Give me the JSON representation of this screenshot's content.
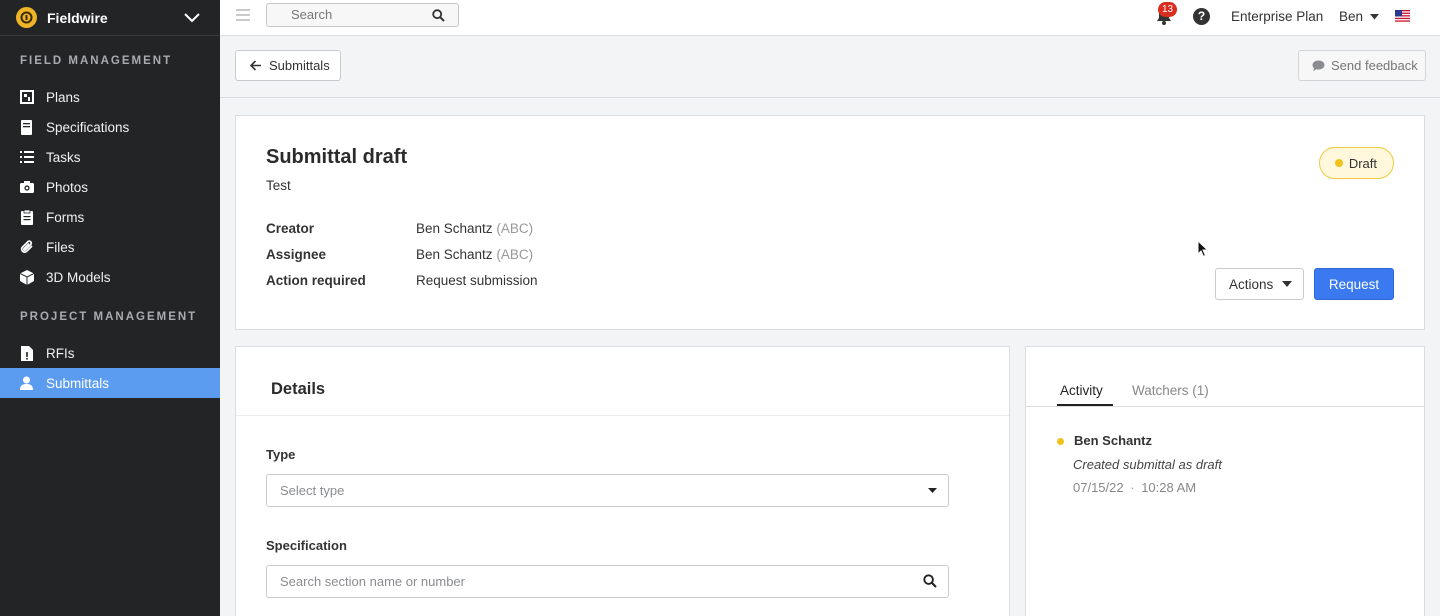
{
  "app": {
    "name": "Fieldwire"
  },
  "sidebar": {
    "sections": [
      {
        "title": "FIELD MANAGEMENT",
        "items": [
          {
            "label": "Plans",
            "icon": "plans-icon"
          },
          {
            "label": "Specifications",
            "icon": "specifications-icon"
          },
          {
            "label": "Tasks",
            "icon": "tasks-icon"
          },
          {
            "label": "Photos",
            "icon": "camera-icon"
          },
          {
            "label": "Forms",
            "icon": "forms-icon"
          },
          {
            "label": "Files",
            "icon": "paperclip-icon"
          },
          {
            "label": "3D Models",
            "icon": "cube-icon"
          }
        ]
      },
      {
        "title": "PROJECT MANAGEMENT",
        "items": [
          {
            "label": "RFIs",
            "icon": "rfi-icon"
          },
          {
            "label": "Submittals",
            "icon": "person-icon",
            "active": true
          }
        ]
      }
    ]
  },
  "topbar": {
    "search_placeholder": "Search",
    "notification_count": "13",
    "help_label": "?",
    "plan_label": "Enterprise Plan",
    "user_label": "Ben",
    "flag_icon": "us-flag-icon"
  },
  "subheader": {
    "back_label": "Submittals",
    "feedback_label": "Send feedback"
  },
  "submittal": {
    "title": "Submittal draft",
    "subtitle": "Test",
    "status": "Draft",
    "meta": [
      {
        "label": "Creator",
        "value": "Ben Schantz",
        "suffix": "(ABC)"
      },
      {
        "label": "Assignee",
        "value": "Ben Schantz",
        "suffix": "(ABC)"
      },
      {
        "label": "Action required",
        "value": "Request submission",
        "suffix": ""
      }
    ],
    "actions_label": "Actions",
    "request_label": "Request"
  },
  "details": {
    "title": "Details",
    "type_label": "Type",
    "type_placeholder": "Select type",
    "spec_label": "Specification",
    "spec_placeholder": "Search section name or number"
  },
  "activity": {
    "tabs": [
      {
        "label": "Activity",
        "active": true
      },
      {
        "label": "Watchers (1)",
        "active": false
      }
    ],
    "entries": [
      {
        "name": "Ben Schantz",
        "description": "Created submittal as draft",
        "date": "07/15/22",
        "time": "10:28 AM"
      }
    ]
  },
  "colors": {
    "sidebar_bg": "#232425",
    "active_nav": "#5b9cf0",
    "primary": "#3a79ef",
    "draft": "#f0c21a",
    "notification": "#d92d20"
  }
}
